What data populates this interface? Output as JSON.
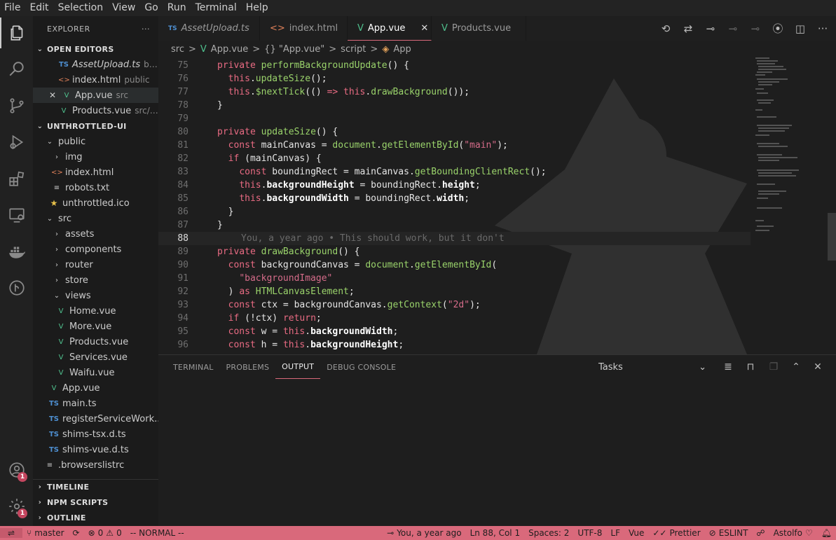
{
  "menu": [
    "File",
    "Edit",
    "Selection",
    "View",
    "Go",
    "Run",
    "Terminal",
    "Help"
  ],
  "activity": {
    "accounts_badge": "1",
    "settings_badge": "1"
  },
  "sidebar": {
    "title": "EXPLORER",
    "more": "···",
    "open_editors_label": "OPEN EDITORS",
    "open_editors": [
      {
        "icon": "TS",
        "name": "AssetUpload.ts",
        "desc": "buil..."
      },
      {
        "icon": "<>",
        "name": "index.html",
        "desc": "public"
      },
      {
        "icon": "V",
        "name": "App.vue",
        "desc": "src",
        "close": "✕"
      },
      {
        "icon": "V",
        "name": "Products.vue",
        "desc": "src/v..."
      }
    ],
    "project_label": "UNTHROTTLED-UI",
    "tree": {
      "public": "public",
      "img": "img",
      "index_html": "index.html",
      "robots": "robots.txt",
      "ico": "unthrottled.ico",
      "src": "src",
      "assets": "assets",
      "components": "components",
      "router": "router",
      "store": "store",
      "views": "views",
      "home": "Home.vue",
      "more": "More.vue",
      "products": "Products.vue",
      "services": "Services.vue",
      "waifu": "Waifu.vue",
      "app": "App.vue",
      "main": "main.ts",
      "register": "registerServiceWork...",
      "shims_tsx": "shims-tsx.d.ts",
      "shims_vue": "shims-vue.d.ts",
      "browserslist": ".browserslistrc"
    },
    "timeline": "TIMELINE",
    "npm": "NPM SCRIPTS",
    "outline": "OUTLINE"
  },
  "tabs": [
    {
      "icon": "TS",
      "label": "AssetUpload.ts"
    },
    {
      "icon": "<>",
      "label": "index.html"
    },
    {
      "icon": "V",
      "label": "App.vue",
      "close": "✕"
    },
    {
      "icon": "V",
      "label": "Products.vue"
    }
  ],
  "breadcrumb": {
    "a": "src",
    "sep": ">",
    "b": "App.vue",
    "c": "{} \"App.vue\"",
    "d": "script",
    "e": "App"
  },
  "code": {
    "l75": "75",
    "l76": "76",
    "l77": "77",
    "l78": "78",
    "l79": "79",
    "l80": "80",
    "l81": "81",
    "l82": "82",
    "l83": "83",
    "l84": "84",
    "l85": "85",
    "l86": "86",
    "l87": "87",
    "l88": "88",
    "l89": "89",
    "l90": "90",
    "l91": "91",
    "l92": "92",
    "l93": "93",
    "l94": "94",
    "l95": "95",
    "l96": "96",
    "blame": "You, a year ago • This should work, but it don't"
  },
  "panel": {
    "tabs": [
      "TERMINAL",
      "PROBLEMS",
      "OUTPUT",
      "DEBUG CONSOLE"
    ],
    "dropdown": "Tasks"
  },
  "status": {
    "branch": "master",
    "errors": "0",
    "warnings": "0",
    "mode": "-- NORMAL --",
    "blame": "You, a year ago",
    "position": "Ln 88, Col 1",
    "spaces": "Spaces: 2",
    "encoding": "UTF-8",
    "eol": "LF",
    "lang": "Vue",
    "prettier": "Prettier",
    "eslint": "ESLINT",
    "user": "Astolfo"
  },
  "colors": {
    "accent": "#d9697b",
    "keyword": "#e96b83",
    "function": "#9ad36b",
    "string": "#d66c8a",
    "vue": "#4fc08d",
    "ts": "#4e8fd1"
  }
}
